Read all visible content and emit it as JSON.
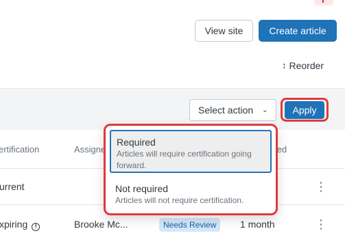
{
  "header": {
    "view_site_label": "View site",
    "create_article_label": "Create article",
    "reorder_label": "Reorder"
  },
  "bulk_actions": {
    "select_label": "Select action",
    "apply_label": "Apply"
  },
  "table": {
    "columns": {
      "certification": "ertification",
      "assignee": "Assigne",
      "updated": "ted"
    },
    "rows": [
      {
        "status": "urrent",
        "assignee": "",
        "badge": "",
        "time": ""
      },
      {
        "status": "xpiring",
        "assignee": "Brooke Mc...",
        "badge": "Needs Review",
        "time": "1 month"
      }
    ]
  },
  "dropdown": {
    "options": [
      {
        "title": "Required",
        "description": "Articles will require certification going forward."
      },
      {
        "title": "Not required",
        "description": "Articles will not require certification."
      }
    ]
  },
  "colors": {
    "primary": "#1f73b7",
    "highlight": "#e03a3a",
    "badge_bg": "#d3e8fb"
  }
}
